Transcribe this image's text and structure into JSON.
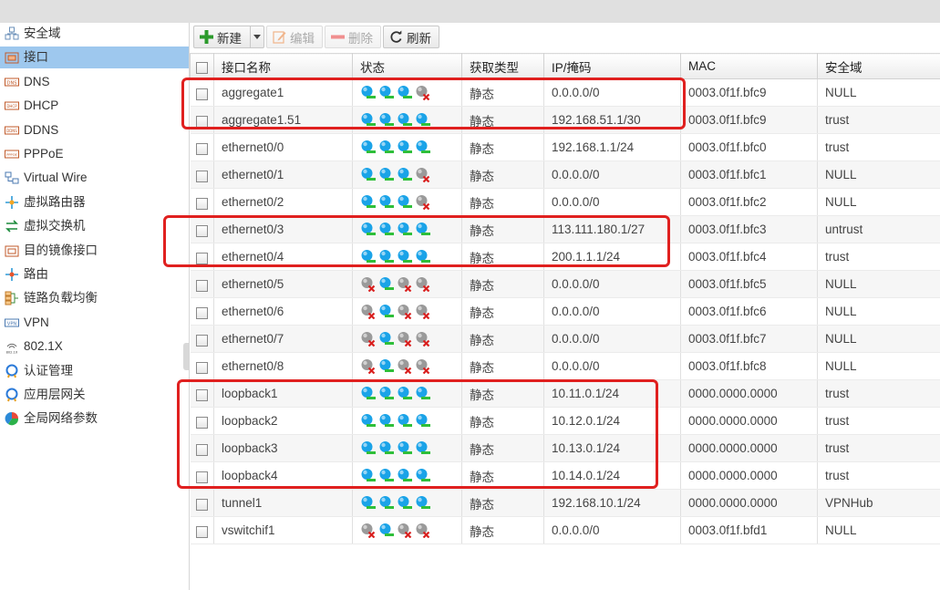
{
  "sidebar": {
    "items": [
      {
        "label": "安全域",
        "icon": "zone-icon",
        "active": false
      },
      {
        "label": "接口",
        "icon": "interface-icon",
        "active": true
      },
      {
        "label": "DNS",
        "icon": "dns-icon",
        "active": false
      },
      {
        "label": "DHCP",
        "icon": "dhcp-icon",
        "active": false
      },
      {
        "label": "DDNS",
        "icon": "ddns-icon",
        "active": false
      },
      {
        "label": "PPPoE",
        "icon": "pppoe-icon",
        "active": false
      },
      {
        "label": "Virtual Wire",
        "icon": "virtual-wire-icon",
        "active": false
      },
      {
        "label": "虚拟路由器",
        "icon": "virtual-router-icon",
        "active": false
      },
      {
        "label": "虚拟交换机",
        "icon": "virtual-switch-icon",
        "active": false
      },
      {
        "label": "目的镜像接口",
        "icon": "mirror-interface-icon",
        "active": false
      },
      {
        "label": "路由",
        "icon": "route-icon",
        "active": false
      },
      {
        "label": "链路负载均衡",
        "icon": "load-balance-icon",
        "active": false
      },
      {
        "label": "VPN",
        "icon": "vpn-icon",
        "active": false
      },
      {
        "label": "802.1X",
        "icon": "dot1x-icon",
        "active": false
      },
      {
        "label": "认证管理",
        "icon": "auth-icon",
        "active": false
      },
      {
        "label": "应用层网关",
        "icon": "alg-icon",
        "active": false
      },
      {
        "label": "全局网络参数",
        "icon": "global-params-icon",
        "active": false
      }
    ]
  },
  "toolbar": {
    "new_label": "新建",
    "edit_label": "编辑",
    "delete_label": "删除",
    "refresh_label": "刷新"
  },
  "table": {
    "headers": [
      "接口名称",
      "状态",
      "获取类型",
      "IP/掩码",
      "MAC",
      "安全域"
    ],
    "rows": [
      {
        "name": "aggregate1",
        "status": [
          1,
          1,
          1,
          0
        ],
        "type": "静态",
        "ip": "0.0.0.0/0",
        "mac": "0003.0f1f.bfc9",
        "zone": "NULL"
      },
      {
        "name": "aggregate1.51",
        "status": [
          1,
          1,
          1,
          1
        ],
        "type": "静态",
        "ip": "192.168.51.1/30",
        "mac": "0003.0f1f.bfc9",
        "zone": "trust"
      },
      {
        "name": "ethernet0/0",
        "status": [
          1,
          1,
          1,
          1
        ],
        "type": "静态",
        "ip": "192.168.1.1/24",
        "mac": "0003.0f1f.bfc0",
        "zone": "trust"
      },
      {
        "name": "ethernet0/1",
        "status": [
          1,
          1,
          1,
          0
        ],
        "type": "静态",
        "ip": "0.0.0.0/0",
        "mac": "0003.0f1f.bfc1",
        "zone": "NULL"
      },
      {
        "name": "ethernet0/2",
        "status": [
          1,
          1,
          1,
          0
        ],
        "type": "静态",
        "ip": "0.0.0.0/0",
        "mac": "0003.0f1f.bfc2",
        "zone": "NULL"
      },
      {
        "name": "ethernet0/3",
        "status": [
          1,
          1,
          1,
          1
        ],
        "type": "静态",
        "ip": "113.111.180.1/27",
        "mac": "0003.0f1f.bfc3",
        "zone": "untrust"
      },
      {
        "name": "ethernet0/4",
        "status": [
          1,
          1,
          1,
          1
        ],
        "type": "静态",
        "ip": "200.1.1.1/24",
        "mac": "0003.0f1f.bfc4",
        "zone": "trust"
      },
      {
        "name": "ethernet0/5",
        "status": [
          0,
          1,
          0,
          0
        ],
        "type": "静态",
        "ip": "0.0.0.0/0",
        "mac": "0003.0f1f.bfc5",
        "zone": "NULL"
      },
      {
        "name": "ethernet0/6",
        "status": [
          0,
          1,
          0,
          0
        ],
        "type": "静态",
        "ip": "0.0.0.0/0",
        "mac": "0003.0f1f.bfc6",
        "zone": "NULL"
      },
      {
        "name": "ethernet0/7",
        "status": [
          0,
          1,
          0,
          0
        ],
        "type": "静态",
        "ip": "0.0.0.0/0",
        "mac": "0003.0f1f.bfc7",
        "zone": "NULL"
      },
      {
        "name": "ethernet0/8",
        "status": [
          0,
          1,
          0,
          0
        ],
        "type": "静态",
        "ip": "0.0.0.0/0",
        "mac": "0003.0f1f.bfc8",
        "zone": "NULL"
      },
      {
        "name": "loopback1",
        "status": [
          1,
          1,
          1,
          1
        ],
        "type": "静态",
        "ip": "10.11.0.1/24",
        "mac": "0000.0000.0000",
        "zone": "trust"
      },
      {
        "name": "loopback2",
        "status": [
          1,
          1,
          1,
          1
        ],
        "type": "静态",
        "ip": "10.12.0.1/24",
        "mac": "0000.0000.0000",
        "zone": "trust"
      },
      {
        "name": "loopback3",
        "status": [
          1,
          1,
          1,
          1
        ],
        "type": "静态",
        "ip": "10.13.0.1/24",
        "mac": "0000.0000.0000",
        "zone": "trust"
      },
      {
        "name": "loopback4",
        "status": [
          1,
          1,
          1,
          1
        ],
        "type": "静态",
        "ip": "10.14.0.1/24",
        "mac": "0000.0000.0000",
        "zone": "trust"
      },
      {
        "name": "tunnel1",
        "status": [
          1,
          1,
          1,
          1
        ],
        "type": "静态",
        "ip": "192.168.10.1/24",
        "mac": "0000.0000.0000",
        "zone": "VPNHub"
      },
      {
        "name": "vswitchif1",
        "status": [
          0,
          1,
          0,
          0
        ],
        "type": "静态",
        "ip": "0.0.0.0/0",
        "mac": "0003.0f1f.bfd1",
        "zone": "NULL"
      }
    ]
  },
  "colors": {
    "active_nav": "#9ec8ee",
    "highlight": "#e0201f",
    "status_up": "#1aa3e8",
    "status_down": "#9a9a9a",
    "status_ok_bar": "#2fbf3a",
    "status_x": "#d9201f"
  }
}
